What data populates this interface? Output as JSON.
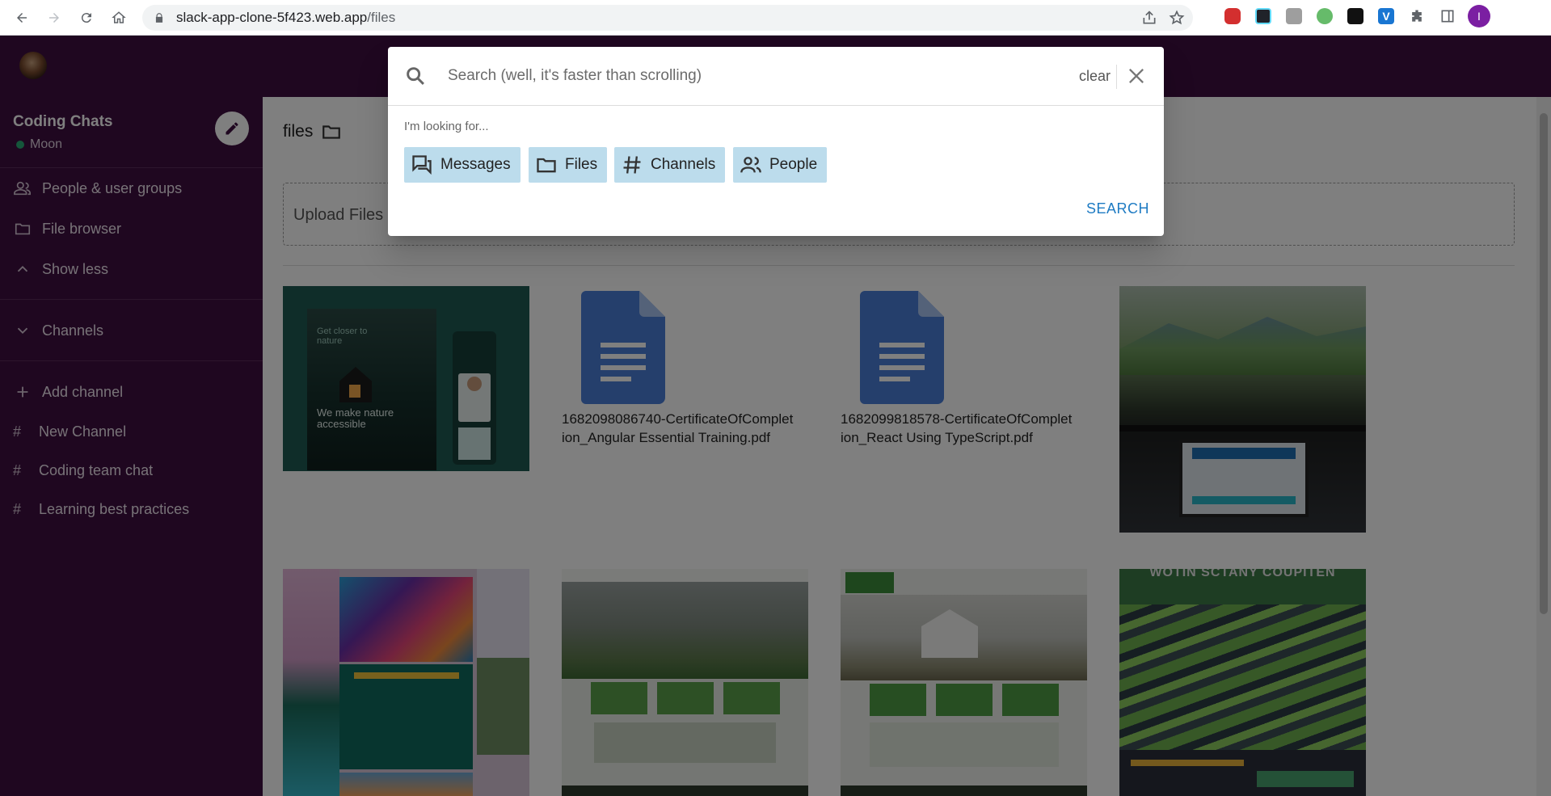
{
  "browser": {
    "url_host": "slack-app-clone-5f423.web.app",
    "url_path": "/files",
    "profile_initial": "I",
    "extensions": [
      "adblock-icon",
      "react-devtools-icon",
      "ext-gray-icon",
      "ext-green-icon",
      "ext-dark-icon",
      "ext-v-icon",
      "puzzle-icon",
      "sidepanel-icon"
    ]
  },
  "workspace": {
    "name": "Coding Chats",
    "user": "Moon"
  },
  "sidebar": {
    "items": [
      {
        "label": "People & user groups",
        "icon": "people-icon"
      },
      {
        "label": "File browser",
        "icon": "folder-icon"
      },
      {
        "label": "Show less",
        "icon": "chevron-up-icon"
      }
    ],
    "channels_header": "Channels",
    "add_channel": "Add channel",
    "channels": [
      {
        "prefix": "#",
        "label": "New Channel"
      },
      {
        "prefix": "#",
        "label": "Coding team chat"
      },
      {
        "prefix": "#",
        "label": "Learning best practices"
      }
    ]
  },
  "main": {
    "title": "files",
    "upload_label": "Upload Files",
    "files": [
      {
        "type": "image",
        "name": "nature-website-mockup"
      },
      {
        "type": "doc",
        "caption": "1682098086740-CertificateOfCompletion_Angular Essential Training.pdf"
      },
      {
        "type": "doc",
        "caption": "1682099818578-CertificateOfCompletion_React Using TypeScript.pdf"
      },
      {
        "type": "image",
        "name": "laptop-landscape-photo"
      },
      {
        "type": "image",
        "name": "colorful-design-collage"
      },
      {
        "type": "image",
        "name": "green-website-mockup"
      },
      {
        "type": "image",
        "name": "barn-website-mockup"
      },
      {
        "type": "image",
        "name": "terraced-landscape-poster"
      }
    ],
    "image_texts": {
      "nature_headline": "We make nature accessible",
      "nature_tag": "Get closer to nature",
      "poster_title": "WOTIN SCTANY COUPITEN"
    }
  },
  "search_dialog": {
    "placeholder": "Search (well, it's faster than scrolling)",
    "clear_label": "clear",
    "looking_for": "I'm looking for...",
    "chips": [
      {
        "label": "Messages",
        "icon": "messages-icon"
      },
      {
        "label": "Files",
        "icon": "folder-icon"
      },
      {
        "label": "Channels",
        "icon": "hash-icon"
      },
      {
        "label": "People",
        "icon": "people-icon"
      }
    ],
    "search_button": "SEARCH"
  },
  "colors": {
    "sidebar_bg": "#3f0e40",
    "chip_bg": "#bcdcec",
    "search_button": "#1e7bc3",
    "doc_blue": "#4a7fd8",
    "status_online": "#2bac76"
  }
}
